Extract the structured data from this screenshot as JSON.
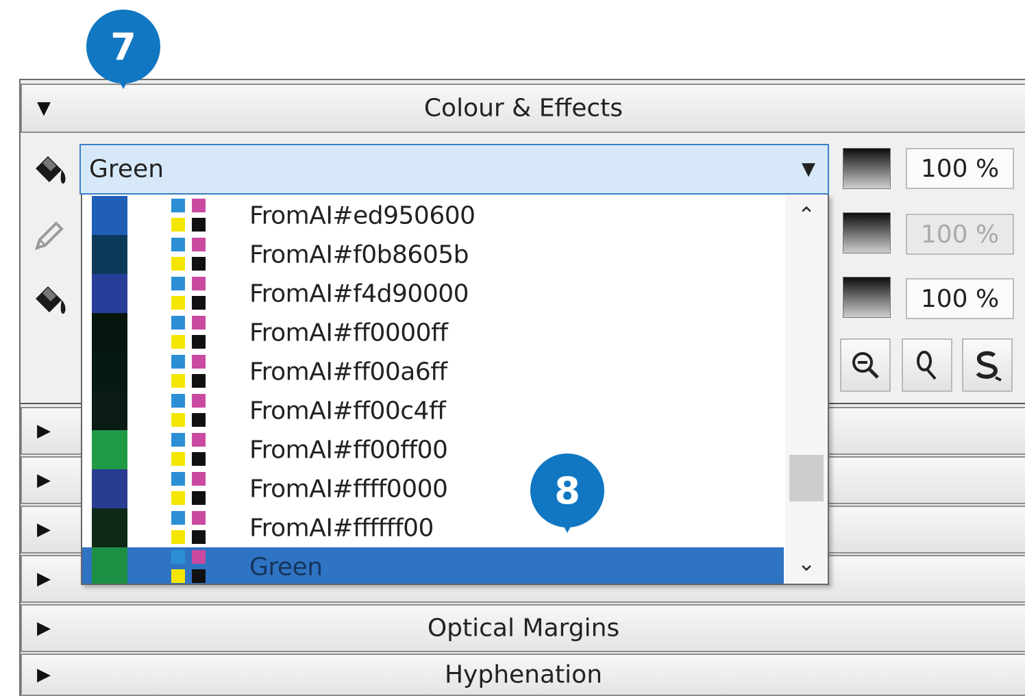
{
  "colour_effects": {
    "title": "Colour & Effects",
    "fill_colour": "Green",
    "opacity_values": [
      "100 %",
      "100 %",
      "100 %"
    ]
  },
  "dropdown": {
    "items": [
      {
        "label": "FromAI#ed950600",
        "swatch": "#1f5fb5"
      },
      {
        "label": "FromAI#f0b8605b",
        "swatch": "#0e3a59"
      },
      {
        "label": "FromAI#f4d90000",
        "swatch": "#283f9a"
      },
      {
        "label": "FromAI#ff0000ff",
        "swatch": "#07150f"
      },
      {
        "label": "FromAI#ff00a6ff",
        "swatch": "#071a11"
      },
      {
        "label": "FromAI#ff00c4ff",
        "swatch": "#0a1c14"
      },
      {
        "label": "FromAI#ff00ff00",
        "swatch": "#1f9b45"
      },
      {
        "label": "FromAI#ffff0000",
        "swatch": "#2a3c91"
      },
      {
        "label": "FromAI#ffffff00",
        "swatch": "#0f2918"
      },
      {
        "label": "Green",
        "swatch": "#1d8f44",
        "selected": true
      }
    ]
  },
  "sections": {
    "optical_margins": "Optical Margins",
    "hyphenation": "Hyphenation"
  },
  "callouts": {
    "seven": "7",
    "eight": "8"
  },
  "colors": {
    "accent": "#1177c2",
    "selection": "#2f73c3",
    "combo_fill": "#d7e9f8"
  }
}
